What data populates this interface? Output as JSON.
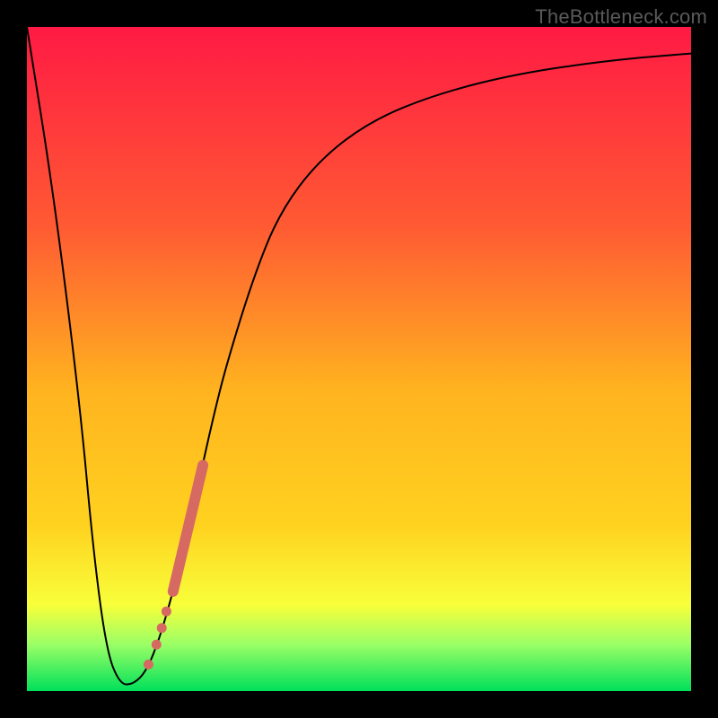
{
  "watermark": "TheBottleneck.com",
  "chart_data": {
    "type": "line",
    "title": "",
    "xlabel": "",
    "ylabel": "",
    "xlim": [
      0,
      100
    ],
    "ylim": [
      0,
      100
    ],
    "background_gradient": {
      "top": "#ff1a44",
      "mid_upper": "#ff7a2a",
      "mid": "#ffd21f",
      "mid_lower": "#f8ff3a",
      "green_band": "#9aff66",
      "bottom": "#00e05a"
    },
    "series": [
      {
        "name": "bottleneck-curve",
        "color": "#000000",
        "stroke_width": 2,
        "x": [
          0,
          4,
          8,
          10,
          12,
          14,
          16,
          18,
          20,
          22,
          24,
          26,
          28,
          30,
          34,
          38,
          44,
          52,
          62,
          74,
          88,
          100
        ],
        "y": [
          100,
          75,
          43,
          21,
          6,
          1,
          1,
          3,
          8,
          15,
          23,
          32,
          41,
          49,
          62,
          72,
          80,
          86,
          90,
          93,
          95,
          96
        ]
      }
    ],
    "markers": {
      "color": "#d66a63",
      "segment": {
        "x1": 22,
        "y1": 15,
        "x2": 26.5,
        "y2": 34,
        "width": 12
      },
      "dots": [
        {
          "x": 21.0,
          "y": 12.0,
          "r": 5.5
        },
        {
          "x": 20.3,
          "y": 9.5,
          "r": 5.5
        },
        {
          "x": 19.5,
          "y": 7.0,
          "r": 5.5
        },
        {
          "x": 18.3,
          "y": 4.0,
          "r": 5.5
        }
      ]
    }
  }
}
